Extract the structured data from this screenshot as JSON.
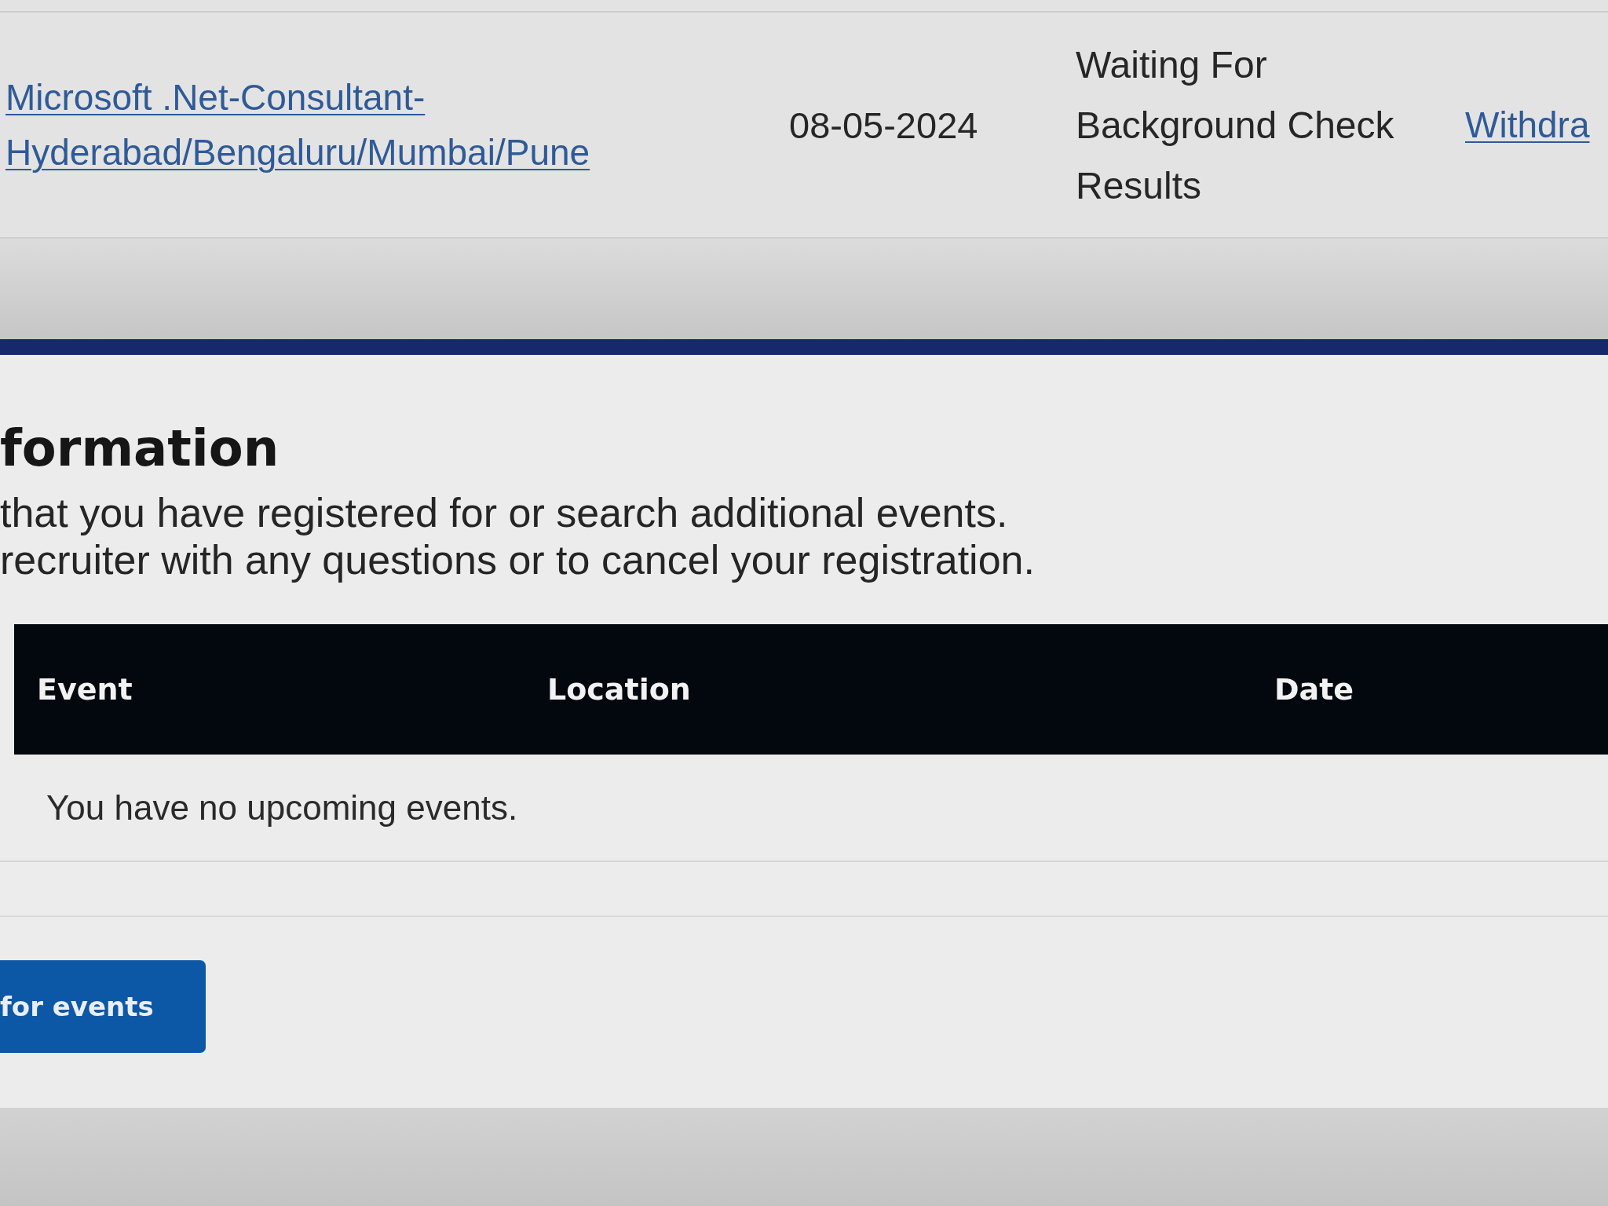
{
  "applications": {
    "rows": [
      {
        "job_title": "Microsoft .Net-Consultant-Hyderabad/Bengaluru/Mumbai/Pune",
        "date": "08-05-2024",
        "status": "Waiting For Background Check Results",
        "action": "Withdra"
      }
    ]
  },
  "events": {
    "title": "formation",
    "description": [
      "that you have registered for or search additional events.",
      "recruiter with any questions or to cancel your registration."
    ],
    "table": {
      "columns": [
        "Event",
        "Location",
        "Date"
      ],
      "empty_message": "You have no upcoming events."
    },
    "button": "for events"
  }
}
